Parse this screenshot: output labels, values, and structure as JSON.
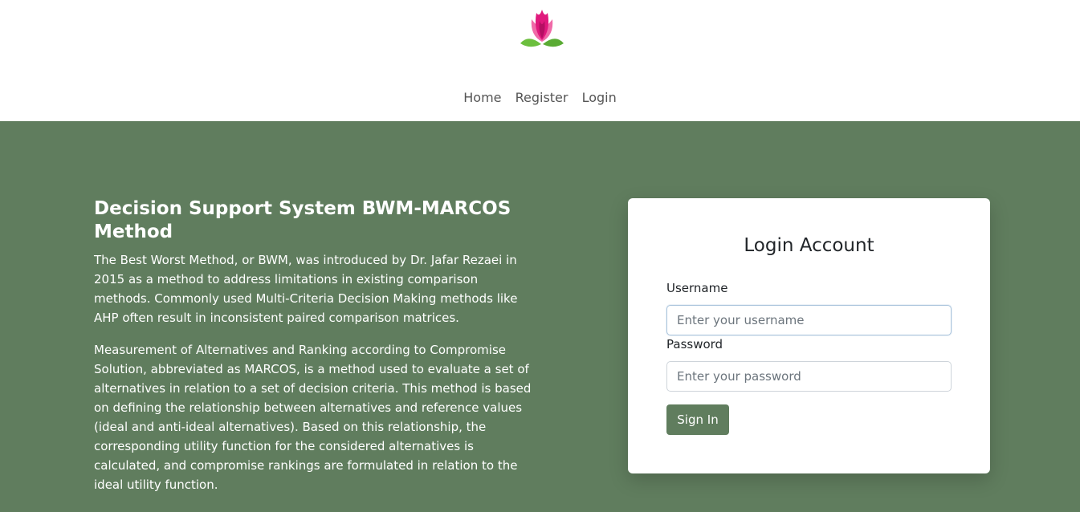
{
  "nav": {
    "home": "Home",
    "register": "Register",
    "login": "Login"
  },
  "intro": {
    "title": "Decision Support System BWM-MARCOS Method",
    "paragraph1": "The Best Worst Method, or BWM, was introduced by Dr. Jafar Rezaei in 2015 as a method to address limitations in existing comparison methods. Commonly used Multi-Criteria Decision Making methods like AHP often result in inconsistent paired comparison matrices.",
    "paragraph2": "Measurement of Alternatives and Ranking according to Compromise Solution, abbreviated as MARCOS, is a method used to evaluate a set of alternatives in relation to a set of decision criteria. This method is based on defining the relationship between alternatives and reference values (ideal and anti-ideal alternatives). Based on this relationship, the corresponding utility function for the considered alternatives is calculated, and compromise rankings are formulated in relation to the ideal utility function."
  },
  "login": {
    "title": "Login Account",
    "username_label": "Username",
    "username_placeholder": "Enter your username",
    "password_label": "Password",
    "password_placeholder": "Enter your password",
    "submit_label": "Sign In"
  },
  "colors": {
    "accent": "#607d5e",
    "logo_petal": "#e0197d",
    "logo_leaf": "#6cbf3e"
  },
  "icons": {
    "logo": "lotus-logo-icon"
  }
}
